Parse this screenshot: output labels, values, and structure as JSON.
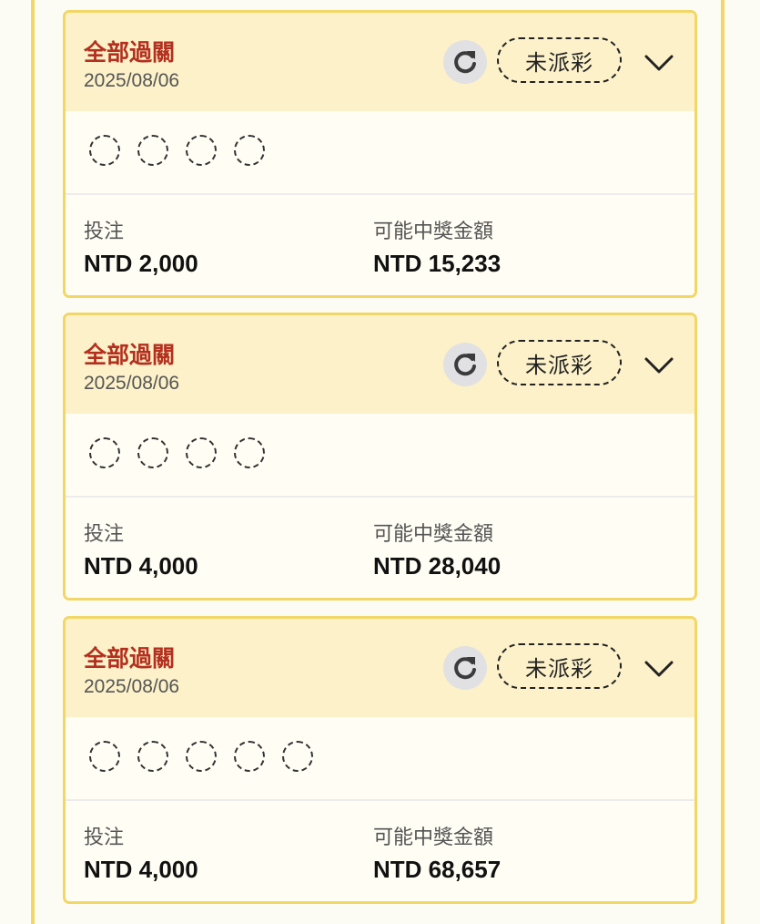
{
  "cards": [
    {
      "bet_type": "全部過關",
      "date": "2025/08/06",
      "status": "未派彩",
      "legs": 4,
      "stake_label": "投注",
      "stake": "NTD 2,000",
      "payout_label": "可能中獎金額",
      "payout": "NTD 15,233"
    },
    {
      "bet_type": "全部過關",
      "date": "2025/08/06",
      "status": "未派彩",
      "legs": 4,
      "stake_label": "投注",
      "stake": "NTD 4,000",
      "payout_label": "可能中獎金額",
      "payout": "NTD 28,040"
    },
    {
      "bet_type": "全部過關",
      "date": "2025/08/06",
      "status": "未派彩",
      "legs": 5,
      "stake_label": "投注",
      "stake": "NTD 4,000",
      "payout_label": "可能中獎金額",
      "payout": "NTD 68,657"
    }
  ],
  "icons": {
    "refresh": "refresh-icon",
    "expand": "chevron-down-icon",
    "leg_placeholder": "dashed-circle-icon"
  },
  "colors": {
    "accent_border": "#f2d766",
    "header_bg": "#fcf1c9",
    "bet_type_text": "#b3301f"
  }
}
